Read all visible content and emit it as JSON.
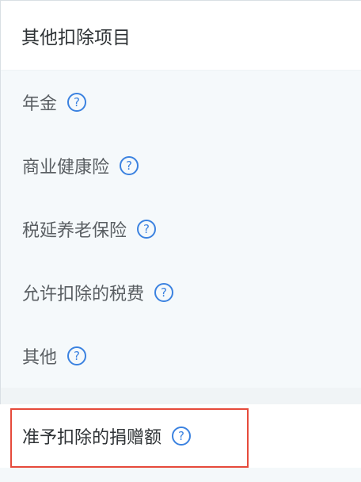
{
  "section": {
    "title": "其他扣除项目",
    "items": [
      {
        "label": "年金",
        "help_icon": "?"
      },
      {
        "label": "商业健康险",
        "help_icon": "?"
      },
      {
        "label": "税延养老保险",
        "help_icon": "?"
      },
      {
        "label": "允许扣除的税费",
        "help_icon": "?"
      },
      {
        "label": "其他",
        "help_icon": "?"
      }
    ]
  },
  "donation": {
    "label": "准予扣除的捐赠额",
    "help_icon": "?"
  },
  "colors": {
    "accent": "#3b82e0",
    "highlight": "#e64a3b"
  }
}
